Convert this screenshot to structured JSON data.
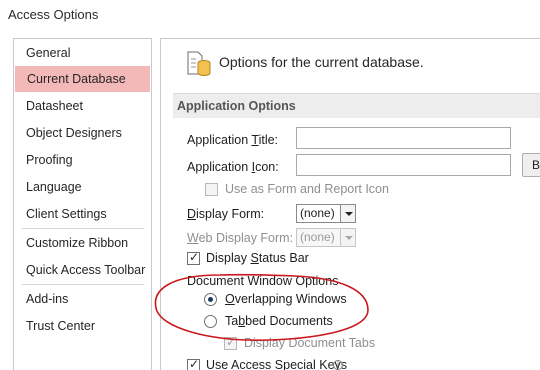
{
  "window": {
    "title": "Access Options"
  },
  "nav": {
    "items": [
      {
        "label": "General"
      },
      {
        "label": "Current Database"
      },
      {
        "label": "Datasheet"
      },
      {
        "label": "Object Designers"
      },
      {
        "label": "Proofing"
      },
      {
        "label": "Language"
      },
      {
        "label": "Client Settings"
      },
      {
        "label": "Customize Ribbon"
      },
      {
        "label": "Quick Access Toolbar"
      },
      {
        "label": "Add-ins"
      },
      {
        "label": "Trust Center"
      }
    ],
    "selected": "Current Database"
  },
  "content": {
    "header": "Options for the current database.",
    "section": "Application Options",
    "app_title": {
      "label_pre": "Application ",
      "label_u": "T",
      "label_post": "itle:",
      "value": ""
    },
    "app_icon": {
      "label_pre": "Application ",
      "label_u": "I",
      "label_post": "con:",
      "value": "",
      "browse": "B"
    },
    "use_as_form_icon": {
      "label": "Use as Form and Report Icon",
      "checked": false,
      "enabled": false
    },
    "display_form": {
      "label_pre": "",
      "label_u": "D",
      "label_post": "isplay Form:",
      "value": "(none)"
    },
    "web_display_form": {
      "label_pre": "",
      "label_u": "W",
      "label_post": "eb Display Form:",
      "value": "(none)",
      "enabled": false
    },
    "display_status_bar": {
      "label_pre": "Display ",
      "label_u": "S",
      "label_post": "tatus Bar",
      "checked": true
    },
    "document_window_options": {
      "label": "Document Window Options",
      "overlapping": {
        "label_pre": "",
        "label_u": "O",
        "label_post": "verlapping Windows",
        "selected": true
      },
      "tabbed": {
        "label_pre": "Ta",
        "label_u": "b",
        "label_post": "bed Documents",
        "selected": false
      },
      "display_doc_tabs": {
        "label": "Display Document Tabs",
        "checked": true,
        "enabled": false
      }
    },
    "use_access_special_keys": {
      "label_pre": "Use Access Special ",
      "label_u": "K",
      "label_post": "eys",
      "checked": true,
      "info": "i"
    }
  },
  "colors": {
    "selected_nav": "#f3b8b8",
    "annotation": "#c8191e"
  }
}
